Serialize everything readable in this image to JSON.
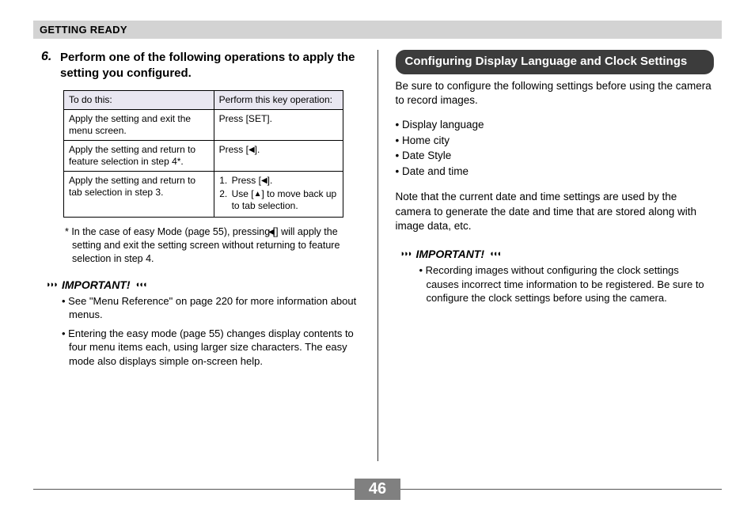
{
  "header": {
    "section": "GETTING READY"
  },
  "left": {
    "step_number": "6.",
    "step_text": "Perform one of the following operations to apply the setting you configured.",
    "table": {
      "head": [
        "To do this:",
        "Perform this key operation:"
      ],
      "rows": [
        {
          "c1": "Apply the setting and exit the menu screen.",
          "c2": "Press [SET]."
        },
        {
          "c1": "Apply the setting and return to feature selection in step 4*.",
          "c2_prefix": "Press [",
          "c2_icon": "◀",
          "c2_suffix": "]."
        },
        {
          "c1": "Apply the setting and return to tab selection in step 3.",
          "c2_l1_prefix": "Press [",
          "c2_l1_icon": "◀",
          "c2_l1_suffix": "].",
          "c2_l2_prefix": "Use [",
          "c2_l2_icon": "▲",
          "c2_l2_suffix": "] to move back up to tab selection."
        }
      ]
    },
    "footnote_prefix": "* In the case of easy Mode (page 55), pressing [",
    "footnote_icon": "◀",
    "footnote_suffix": "] will apply the setting and exit the setting screen without returning to feature selection in step 4.",
    "important_label": "IMPORTANT!",
    "bullets": [
      "See \"Menu Reference\" on page 220 for more information about menus.",
      "Entering the easy mode (page 55) changes display contents to four menu items each, using larger size characters. The easy mode also displays simple on-screen help."
    ]
  },
  "right": {
    "section_title": "Configuring Display Language and Clock Settings",
    "intro": "Be sure to configure the following settings before using the camera to record images.",
    "list": [
      "Display language",
      "Home city",
      "Date Style",
      "Date and time"
    ],
    "note": "Note that the current date and time settings are used by the camera to generate the date and time that are stored along with image data, etc.",
    "important_label": "IMPORTANT!",
    "imp_bullet": "Recording images without configuring the clock settings causes incorrect time information to be registered. Be sure to configure the clock settings before using the camera."
  },
  "page_number": "46"
}
